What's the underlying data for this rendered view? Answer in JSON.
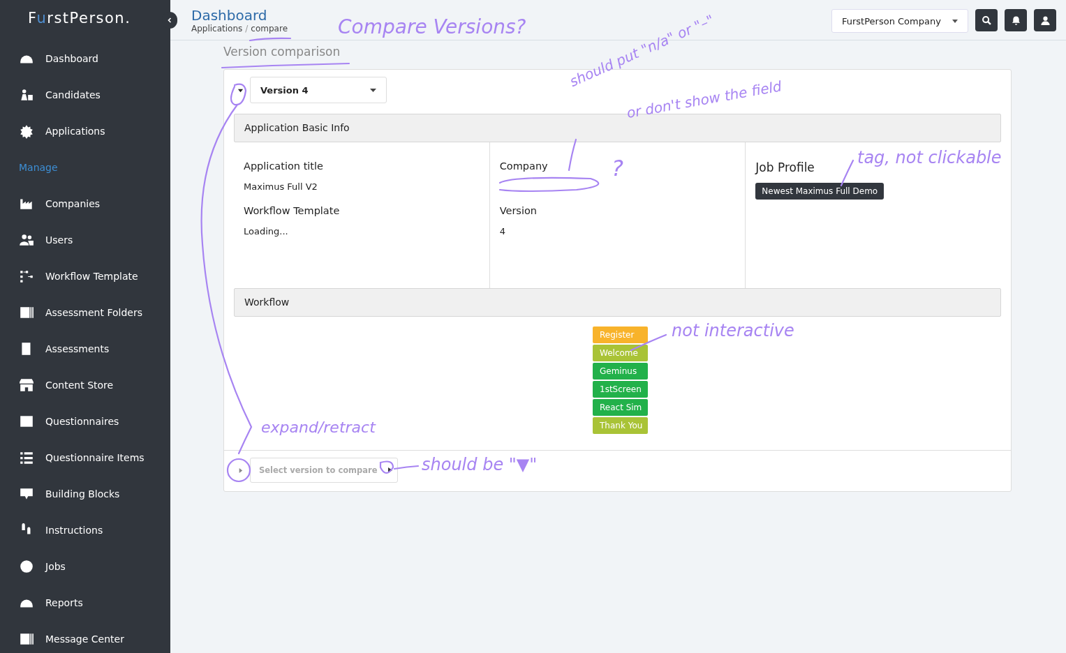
{
  "sidebar": {
    "logo": {
      "before": "F",
      "accent": "u",
      "after": "rstPerson."
    },
    "items": [
      {
        "kind": "item",
        "label": "Dashboard"
      },
      {
        "kind": "item",
        "label": "Candidates"
      },
      {
        "kind": "item",
        "label": "Applications"
      },
      {
        "kind": "section",
        "label": "Manage"
      },
      {
        "kind": "item",
        "label": "Companies"
      },
      {
        "kind": "item",
        "label": "Users"
      },
      {
        "kind": "item",
        "label": "Workflow Template"
      },
      {
        "kind": "item",
        "label": "Assessment Folders"
      },
      {
        "kind": "item",
        "label": "Assessments"
      },
      {
        "kind": "item",
        "label": "Content Store"
      },
      {
        "kind": "item",
        "label": "Questionnaires"
      },
      {
        "kind": "item",
        "label": "Questionnaire Items"
      },
      {
        "kind": "item",
        "label": "Building Blocks"
      },
      {
        "kind": "item",
        "label": "Instructions"
      },
      {
        "kind": "item",
        "label": "Jobs"
      },
      {
        "kind": "item",
        "label": "Reports"
      },
      {
        "kind": "item",
        "label": "Message Center"
      }
    ]
  },
  "header": {
    "title": "Dashboard",
    "breadcrumb": [
      "Applications",
      "compare"
    ],
    "breadcrumb_separator": "/",
    "company_select": "FurstPerson Company"
  },
  "page_title": "Version comparison",
  "version_select": {
    "value": "Version 4",
    "expanded": true
  },
  "basic_info": {
    "title": "Application Basic Info",
    "columns": [
      [
        {
          "label": "Application title",
          "value": "Maximus Full V2"
        },
        {
          "label": "Workflow Template",
          "value": "Loading..."
        }
      ],
      [
        {
          "label": "Company"
        },
        {
          "label": "Version",
          "value": "4"
        }
      ]
    ],
    "job_profile": {
      "label": "Job Profile",
      "tag": "Newest Maximus Full Demo"
    }
  },
  "workflow": {
    "title": "Workflow",
    "steps": [
      {
        "label": "Register",
        "color": "#f8b32b"
      },
      {
        "label": "Welcome",
        "color": "#a9c336"
      },
      {
        "label": "Geminus",
        "color": "#22b14a"
      },
      {
        "label": "1stScreen",
        "color": "#22b14a"
      },
      {
        "label": "React Sim",
        "color": "#22b14a"
      },
      {
        "label": "Thank You",
        "color": "#a9c336"
      }
    ]
  },
  "compare_select": {
    "placeholder": "Select version to compare",
    "expanded": false
  },
  "annotations": [
    "Compare Versions?",
    "should put \"n/a\" or \"–\"",
    "or don't show the field",
    "?",
    "tag, not clickable",
    "not interactive",
    "expand/retract",
    "should be \"▼\""
  ]
}
